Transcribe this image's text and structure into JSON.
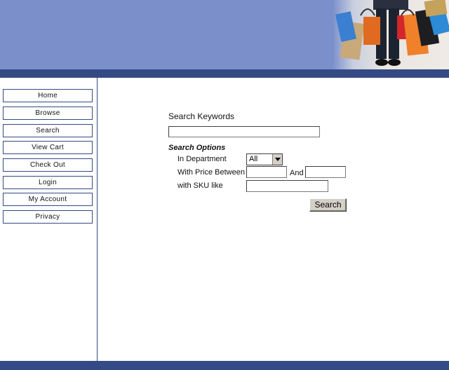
{
  "nav": {
    "items": [
      {
        "label": "Home"
      },
      {
        "label": "Browse"
      },
      {
        "label": "Search"
      },
      {
        "label": "View Cart"
      },
      {
        "label": "Check Out"
      },
      {
        "label": "Login"
      },
      {
        "label": "My Account"
      },
      {
        "label": "Privacy"
      }
    ]
  },
  "search": {
    "keywords_label": "Search Keywords",
    "keywords_value": "",
    "options_heading": "Search Options",
    "department_label": "In Department",
    "department_selected": "All",
    "price_label": "With Price Between",
    "price_and_label": "And",
    "price_min_value": "",
    "price_max_value": "",
    "sku_label": "with SKU like",
    "sku_value": "",
    "submit_label": "Search"
  },
  "colors": {
    "header_background": "#7b8fcb",
    "stripe": "#344a84"
  },
  "banner": {
    "image": "shopping-bags-photo"
  }
}
